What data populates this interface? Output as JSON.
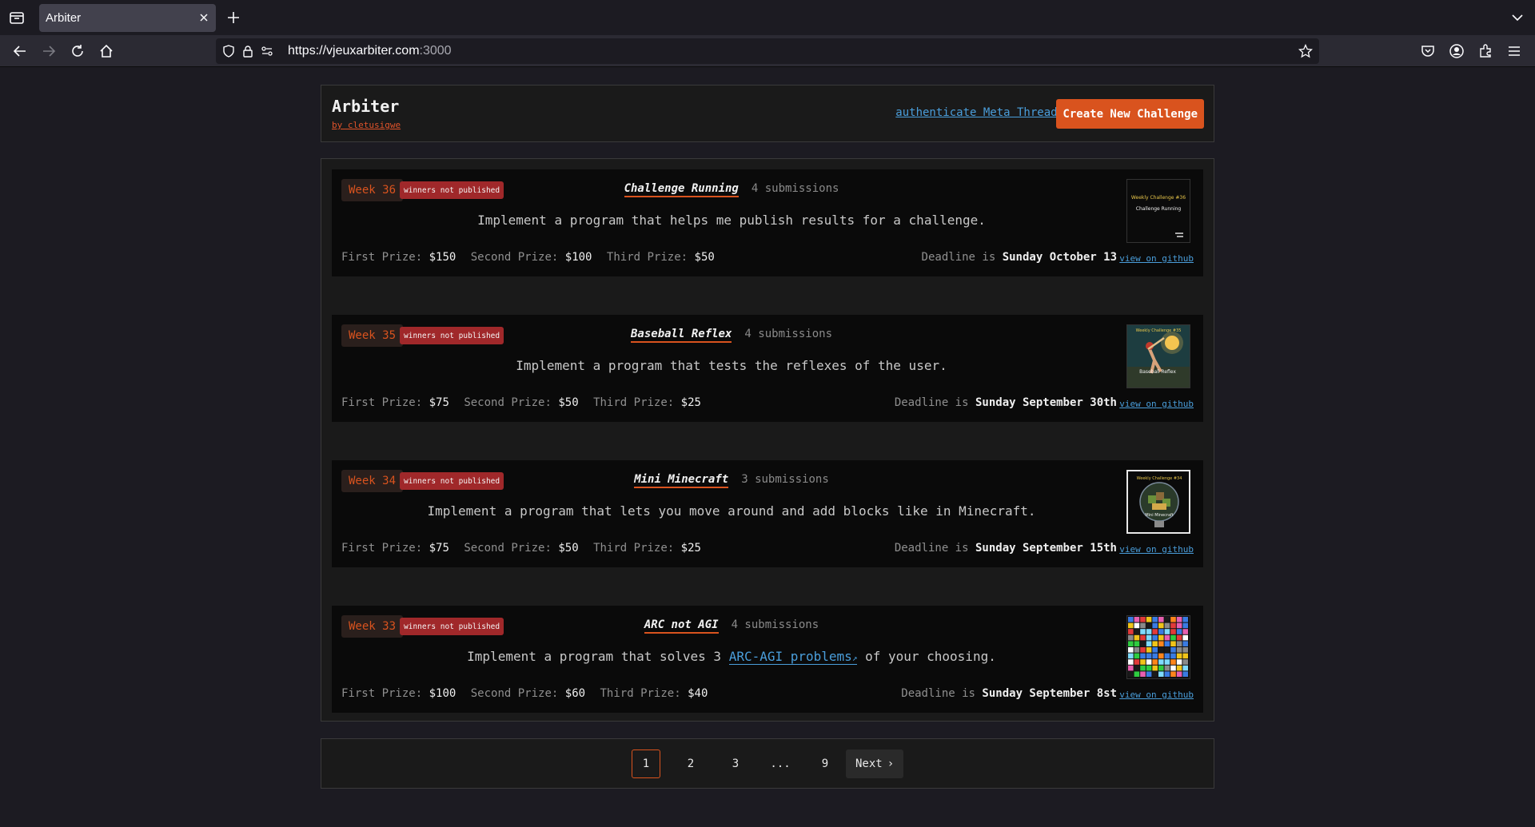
{
  "browser": {
    "tab_title": "Arbiter",
    "url_main": "https://vjeuxarbiter.com",
    "url_port": ":3000"
  },
  "header": {
    "title": "Arbiter",
    "author": "by cletusigwe",
    "auth_link": "authenticate Meta Threads",
    "create_button": "Create New Challenge"
  },
  "challenges": [
    {
      "week": "Week 36",
      "status": "winners not published",
      "title": "Challenge Running",
      "submissions": "4 submissions",
      "description": "Implement a program that helps me publish results for a challenge.",
      "first_label": "First Prize:",
      "first": "$150",
      "second_label": "Second Prize:",
      "second": "$100",
      "third_label": "Third Prize:",
      "third": "$50",
      "deadline_label": "Deadline is",
      "deadline": "Sunday October 13",
      "github": "view on github",
      "thumb_heading": "Weekly Challenge #36",
      "thumb_title": "Challenge Running"
    },
    {
      "week": "Week 35",
      "status": "winners not published",
      "title": "Baseball Reflex",
      "submissions": "4 submissions",
      "description": "Implement a program that tests the reflexes of the user.",
      "first_label": "First Prize:",
      "first": "$75",
      "second_label": "Second Prize:",
      "second": "$50",
      "third_label": "Third Prize:",
      "third": "$25",
      "deadline_label": "Deadline is",
      "deadline": "Sunday September 30th",
      "github": "view on github",
      "thumb_heading": "Weekly Challenge #35",
      "thumb_title": "Baseball Reflex"
    },
    {
      "week": "Week 34",
      "status": "winners not published",
      "title": "Mini Minecraft",
      "submissions": "3 submissions",
      "description": "Implement a program that lets you move around and add blocks like in Minecraft.",
      "first_label": "First Prize:",
      "first": "$75",
      "second_label": "Second Prize:",
      "second": "$50",
      "third_label": "Third Prize:",
      "third": "$25",
      "deadline_label": "Deadline is",
      "deadline": "Sunday September 15th",
      "github": "view on github",
      "thumb_heading": "Weekly Challenge #34",
      "thumb_title": "Mini Minecraft"
    },
    {
      "week": "Week 33",
      "status": "winners not published",
      "title": "ARC not AGI",
      "submissions": "4 submissions",
      "description_before": "Implement a program that solves 3",
      "description_link": "ARC-AGI problems",
      "description_after": "of your choosing.",
      "first_label": "First Prize:",
      "first": "$100",
      "second_label": "Second Prize:",
      "second": "$60",
      "third_label": "Third Prize:",
      "third": "$40",
      "deadline_label": "Deadline is",
      "deadline": "Sunday September 8st",
      "github": "view on github"
    }
  ],
  "pagination": {
    "pages": [
      "1",
      "2",
      "3",
      "...",
      "9"
    ],
    "next": "Next"
  },
  "colors": {
    "accent": "#d9531e",
    "link": "#4a9edb",
    "badge_red": "#a0282a"
  }
}
